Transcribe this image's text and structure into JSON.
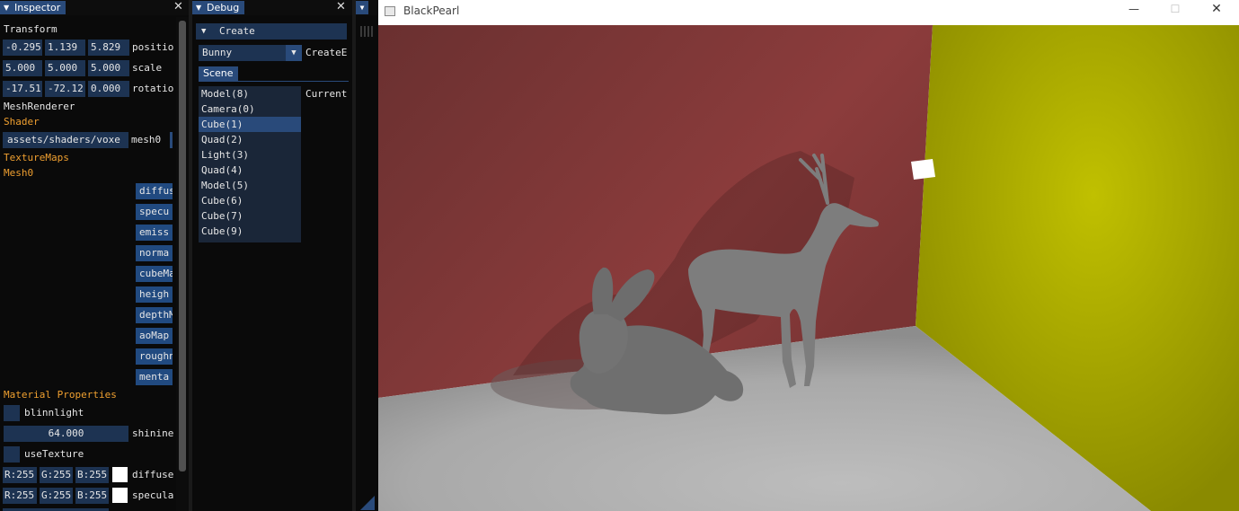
{
  "inspector": {
    "tab_title": "Inspector",
    "transform_header": "Transform",
    "position": {
      "values": [
        "-0.295",
        "1.139",
        "5.829"
      ],
      "label": "positio"
    },
    "scale": {
      "values": [
        "5.000",
        "5.000",
        "5.000"
      ],
      "label": "scale"
    },
    "rotation": {
      "values": [
        "-17.51",
        "-72.12",
        "0.000"
      ],
      "label": "rotatio"
    },
    "mesh_renderer_header": "MeshRenderer",
    "shader_header": "Shader",
    "shader_path": "assets/shaders/voxe",
    "mesh_label": "mesh0",
    "texture_maps_header": "TextureMaps",
    "mesh0_header": "Mesh0",
    "texture_buttons": [
      "diffus",
      "specu",
      "emiss",
      "norma",
      "cubeMa",
      "heigh",
      "depthM",
      "aoMap",
      "roughn",
      "menta"
    ],
    "material_header": "Material Properties",
    "blinnlight_label": "blinnlight",
    "shininess_value": "64.000",
    "shininess_label": "shinine",
    "use_texture_label": "useTexture",
    "diffuse": {
      "r": "R:255",
      "g": "G:255",
      "b": "B:255",
      "label": "diffuse"
    },
    "specular": {
      "r": "R:255",
      "g": "G:255",
      "b": "B:255",
      "label": "specula"
    }
  },
  "debug": {
    "tab_title": "Debug",
    "create_header": "Create",
    "combo_value": "Bunny",
    "create_entity_label": "CreateE",
    "scene_tab": "Scene",
    "current_label": "Current",
    "scene_items": [
      "Model(8)",
      "Camera(0)",
      "Cube(1)",
      "Quad(2)",
      "Light(3)",
      "Quad(4)",
      "Model(5)",
      "Cube(6)",
      "Cube(7)",
      "Cube(9)"
    ],
    "selected_index": 2
  },
  "window": {
    "title": "BlackPearl",
    "minimize_glyph": "—",
    "maximize_glyph": "☐",
    "close_glyph": "✕"
  },
  "icons": {
    "collapse_tri": "▼",
    "close_x": "✕",
    "combo_arrow": "▼"
  },
  "colors": {
    "accent": "#294a7a",
    "field_bg": "#1d3352",
    "header_orange": "#f0a030",
    "wall_left": "#8a3a3a",
    "wall_right": "#b8b800",
    "floor": "#bdbdbd"
  }
}
